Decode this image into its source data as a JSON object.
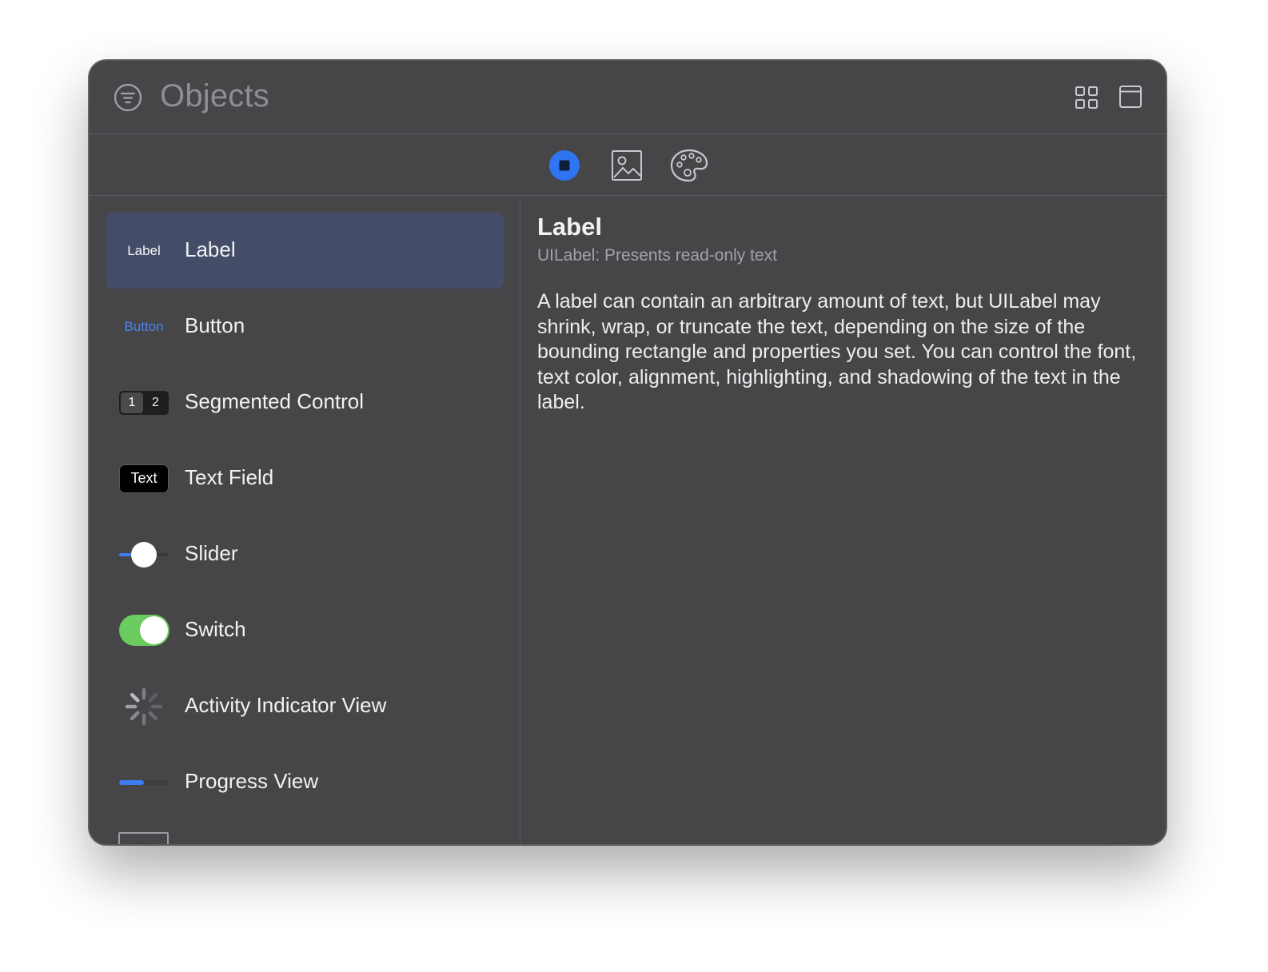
{
  "header": {
    "title": "Objects",
    "filter_icon": "line-3-horizontal-decrease-circle-icon",
    "grid_icon": "square-grid-2x2-icon",
    "window_icon": "macwindow-icon"
  },
  "library_types": [
    {
      "name": "objects",
      "icon": "square-circle-fill-icon",
      "selected": true
    },
    {
      "name": "media",
      "icon": "photo-icon",
      "selected": false
    },
    {
      "name": "colors",
      "icon": "paintpalette-icon",
      "selected": false
    }
  ],
  "items": [
    {
      "label": "Label",
      "thumb_text": "Label",
      "selected": true
    },
    {
      "label": "Button",
      "thumb_text": "Button"
    },
    {
      "label": "Segmented Control",
      "thumb_segments": [
        "1",
        "2"
      ]
    },
    {
      "label": "Text Field",
      "thumb_text": "Text"
    },
    {
      "label": "Slider",
      "slider_value": 0.5
    },
    {
      "label": "Switch",
      "switch_on": true
    },
    {
      "label": "Activity Indicator View",
      "icon": "activity-spinner-icon"
    },
    {
      "label": "Progress View",
      "progress_value": 0.5
    }
  ],
  "detail": {
    "title": "Label",
    "subtitle": "UILabel: Presents read-only text",
    "body": "A label can contain an arbitrary amount of text, but UILabel may shrink, wrap, or truncate the text, depending on the size of the bounding rectangle and properties you set. You can control the font, text color, alignment, highlighting, and shadowing of the text in the label."
  },
  "colors": {
    "window_bg": "#464548",
    "selected_row": "#444d68",
    "accent_blue": "#3d7cf0",
    "switch_green": "#6acb5e"
  }
}
